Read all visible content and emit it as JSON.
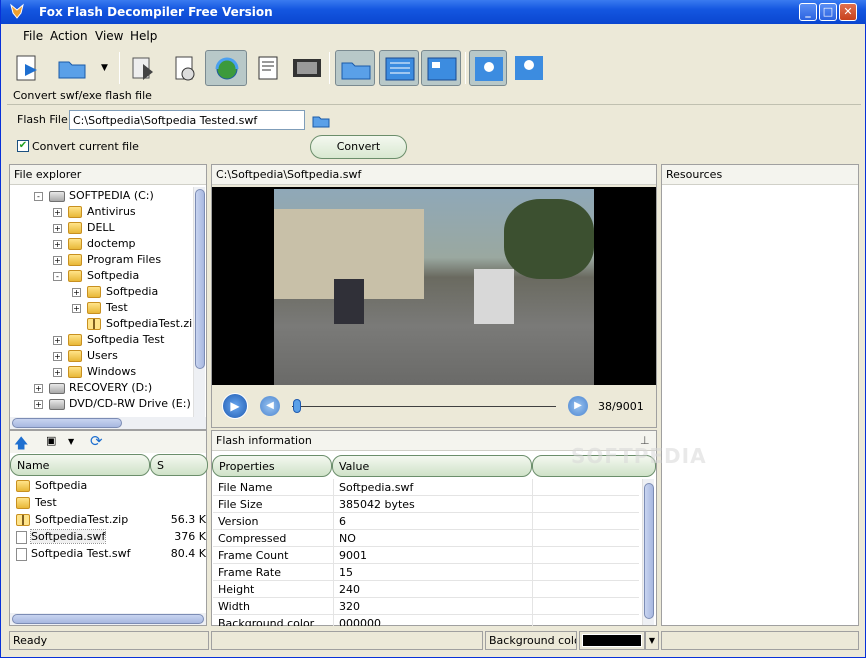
{
  "window": {
    "title": "Fox Flash Decompiler Free Version"
  },
  "menu": [
    "File",
    "Action",
    "View",
    "Help"
  ],
  "toolbar": {
    "hint": "Convert swf/exe flash file"
  },
  "flash_file": {
    "label": "Flash File:",
    "value": "C:\\Softpedia\\Softpedia Tested.swf"
  },
  "convert_current": {
    "label": "Convert current file",
    "checked": true
  },
  "convert_button": "Convert",
  "explorer": {
    "title": "File explorer",
    "tree": [
      {
        "label": "SOFTPEDIA (C:)",
        "kind": "drive",
        "level": 0,
        "exp": "-"
      },
      {
        "label": "Antivirus",
        "kind": "folder",
        "level": 1,
        "exp": "+"
      },
      {
        "label": "DELL",
        "kind": "folder",
        "level": 1,
        "exp": "+"
      },
      {
        "label": "doctemp",
        "kind": "folder",
        "level": 1,
        "exp": "+"
      },
      {
        "label": "Program Files",
        "kind": "folder",
        "level": 1,
        "exp": "+"
      },
      {
        "label": "Softpedia",
        "kind": "folder",
        "level": 1,
        "exp": "-"
      },
      {
        "label": "Softpedia",
        "kind": "folder",
        "level": 2,
        "exp": "+"
      },
      {
        "label": "Test",
        "kind": "folder",
        "level": 2,
        "exp": "+"
      },
      {
        "label": "SoftpediaTest.zip",
        "kind": "zip",
        "level": 2,
        "exp": ""
      },
      {
        "label": "Softpedia Test",
        "kind": "folder",
        "level": 1,
        "exp": "+"
      },
      {
        "label": "Users",
        "kind": "folder",
        "level": 1,
        "exp": "+"
      },
      {
        "label": "Windows",
        "kind": "folder",
        "level": 1,
        "exp": "+"
      },
      {
        "label": "RECOVERY (D:)",
        "kind": "drive",
        "level": 0,
        "exp": "+"
      },
      {
        "label": "DVD/CD-RW Drive (E:)",
        "kind": "drive",
        "level": 0,
        "exp": "+"
      }
    ]
  },
  "files": {
    "columns": [
      "Name",
      "S"
    ],
    "rows": [
      {
        "name": "Softpedia",
        "size": "",
        "kind": "folder"
      },
      {
        "name": "Test",
        "size": "",
        "kind": "folder"
      },
      {
        "name": "SoftpediaTest.zip",
        "size": "56.3 K",
        "kind": "zip"
      },
      {
        "name": "Softpedia.swf",
        "size": "376 K",
        "kind": "file",
        "selected": true
      },
      {
        "name": "Softpedia Test.swf",
        "size": "80.4 K",
        "kind": "file"
      }
    ]
  },
  "player": {
    "path": "C:\\Softpedia\\Softpedia.swf",
    "frame": "38/9001",
    "progress": 0.004
  },
  "flash_info": {
    "title": "Flash information",
    "columns": [
      "Properties",
      "Value"
    ],
    "rows": [
      {
        "k": "File Name",
        "v": "Softpedia.swf"
      },
      {
        "k": "File Size",
        "v": "385042 bytes"
      },
      {
        "k": "Version",
        "v": "6"
      },
      {
        "k": "Compressed",
        "v": "NO"
      },
      {
        "k": "Frame Count",
        "v": "9001"
      },
      {
        "k": "Frame Rate",
        "v": "15"
      },
      {
        "k": "Height",
        "v": "240"
      },
      {
        "k": "Width",
        "v": "320"
      },
      {
        "k": "Background color",
        "v": "000000"
      }
    ]
  },
  "resources": {
    "title": "Resources"
  },
  "status": {
    "ready": "Ready",
    "bg_label": "Background colo"
  },
  "watermark": "SOFTPEDIA",
  "colors": {
    "accent": "#0a46d0",
    "panel": "#ece9d8",
    "pill": "#cfe2c8"
  }
}
